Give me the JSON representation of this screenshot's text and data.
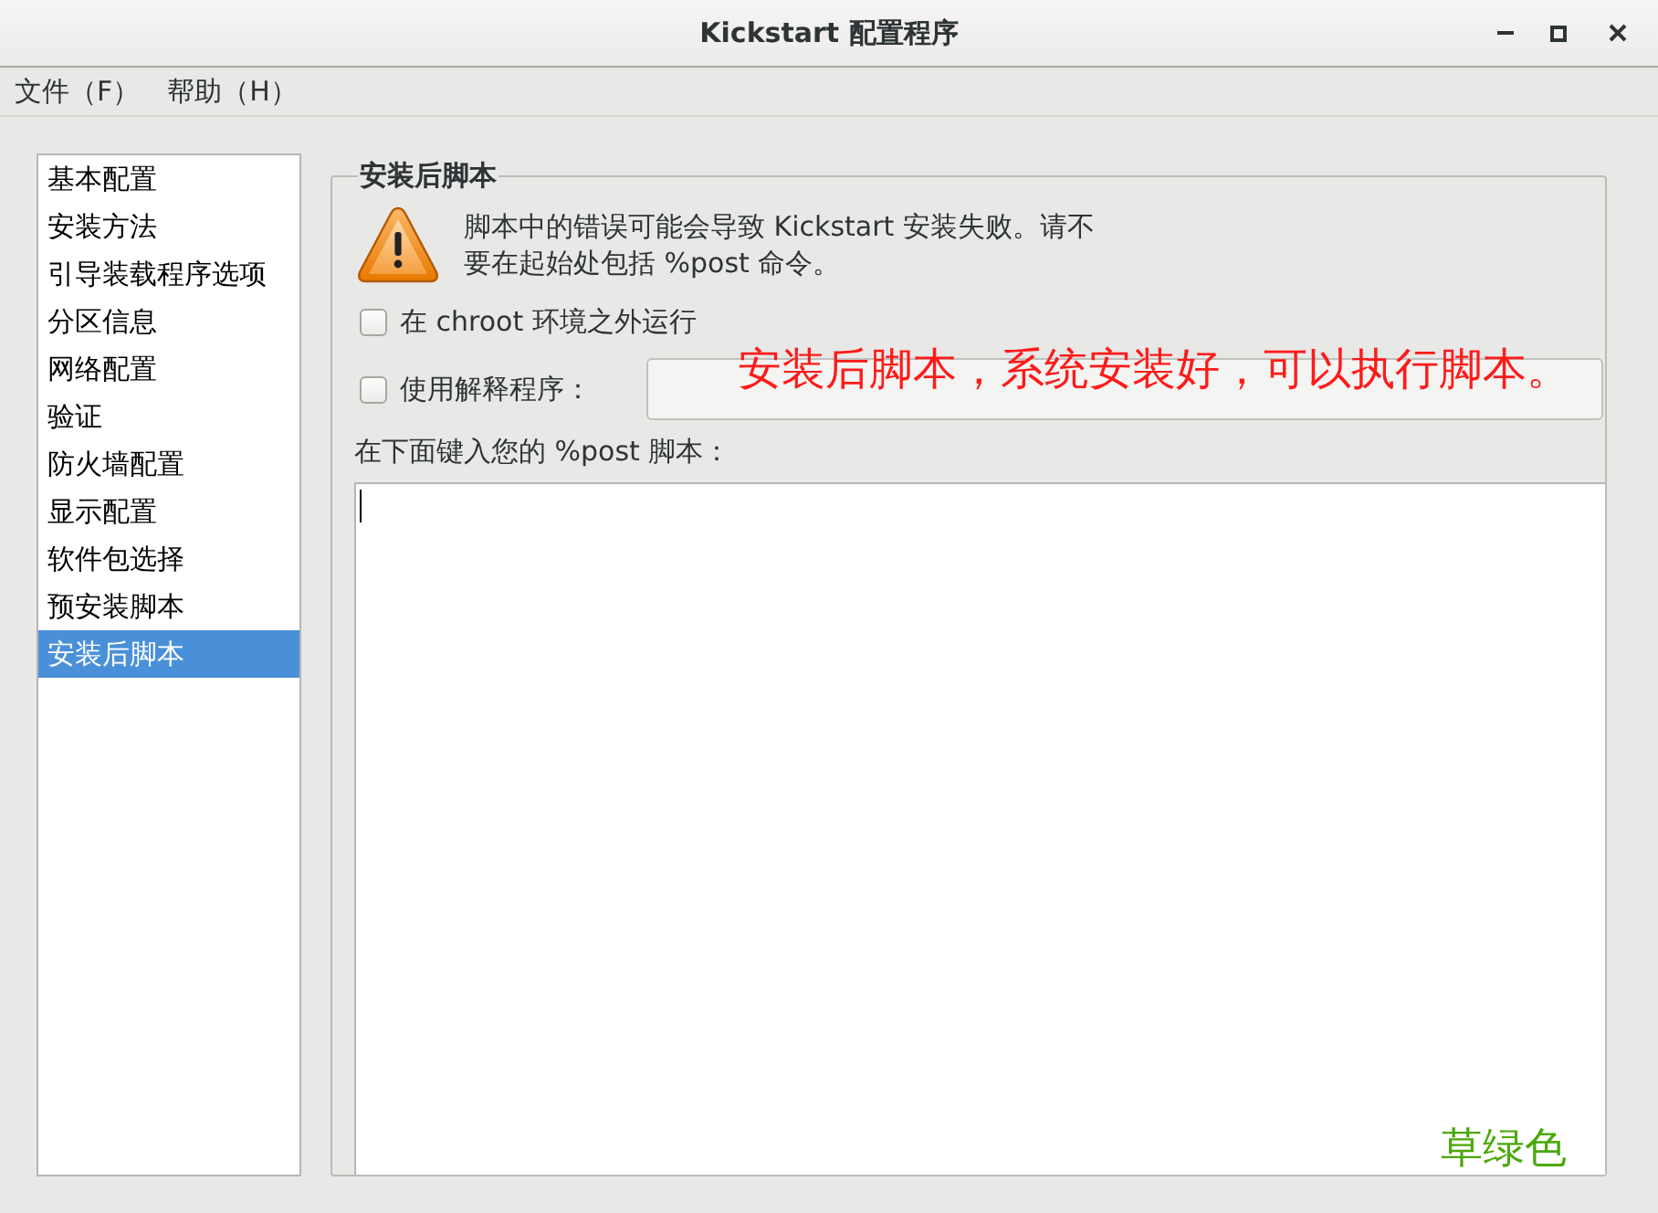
{
  "window": {
    "title": "Kickstart 配置程序"
  },
  "menu": [
    "文件（F）",
    "帮助（H）"
  ],
  "sidebar": {
    "items": [
      {
        "label": "基本配置",
        "selected": false
      },
      {
        "label": "安装方法",
        "selected": false
      },
      {
        "label": "引导装载程序选项",
        "selected": false
      },
      {
        "label": "分区信息",
        "selected": false
      },
      {
        "label": "网络配置",
        "selected": false
      },
      {
        "label": "验证",
        "selected": false
      },
      {
        "label": "防火墙配置",
        "selected": false
      },
      {
        "label": "显示配置",
        "selected": false
      },
      {
        "label": "软件包选择",
        "selected": false
      },
      {
        "label": "预安装脚本",
        "selected": false
      },
      {
        "label": "安装后脚本",
        "selected": true
      }
    ]
  },
  "panel": {
    "title": "安装后脚本",
    "warning": "脚本中的错误可能会导致 Kickstart 安装失败。请不要在起始处包括 %post 命令。",
    "options": [
      {
        "kind": "checkbox",
        "label": "在 chroot 环境之外运行",
        "checked": false
      },
      {
        "kind": "checkbox-field",
        "label": "使用解释程序：",
        "checked": false
      }
    ],
    "script_label": "在下面键入您的 %post 脚本："
  },
  "annotations": [
    {
      "kind": "callout",
      "text": "安装后脚本，系统安装好，可以执行脚本。",
      "color": "#ff1a1a"
    },
    {
      "kind": "note",
      "text": "草绿色",
      "color": "#4aa80a"
    }
  ]
}
